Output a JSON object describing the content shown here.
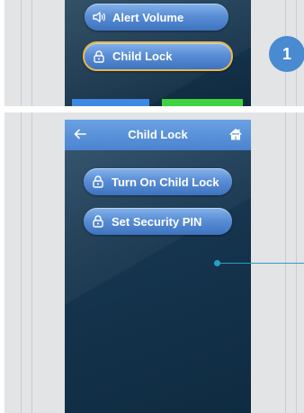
{
  "step_badge": "1",
  "top_screen": {
    "items": [
      {
        "label": "Alert Volume",
        "icon": "speaker-icon"
      },
      {
        "label": "Child Lock",
        "icon": "lock-icon",
        "selected": true
      }
    ]
  },
  "bottom_screen": {
    "title": "Child Lock",
    "back_icon": "back-arrow-icon",
    "home_icon": "home-icon",
    "items": [
      {
        "label": "Turn On Child Lock",
        "icon": "lock-icon"
      },
      {
        "label": "Set Security PIN",
        "icon": "lock-icon"
      }
    ]
  },
  "colors": {
    "button_blue": "#5a8ed6",
    "selected_outline": "#e8b84a",
    "badge": "#4a8ad0",
    "callout": "#2a9fc4",
    "strip_blue": "#3f89e0",
    "strip_green": "#3fd43f"
  }
}
